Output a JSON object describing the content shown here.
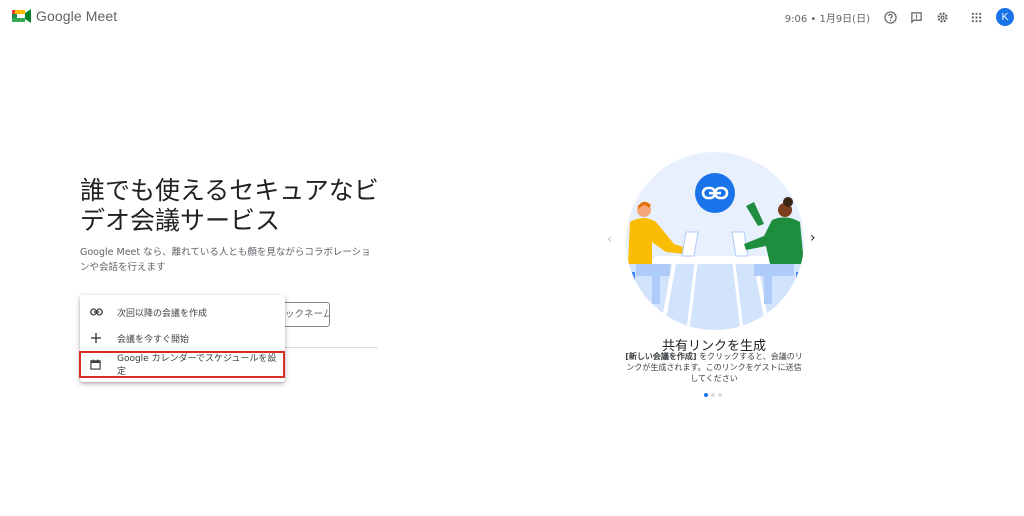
{
  "header": {
    "app_name": "Google Meet",
    "clock": "9:06 • 1月9日(日)",
    "avatar_letter": "K"
  },
  "hero": {
    "title": "誰でも使えるセキュアなビデオ会議サービス",
    "subtitle": "Google Meet なら、離れている人とも顔を見ながらコラボレーションや会話を行えます",
    "nickname_partial": "ックネームを"
  },
  "menu": {
    "items": [
      {
        "label": "次回以降の会議を作成",
        "icon": "link-icon"
      },
      {
        "label": "会議を今すぐ開始",
        "icon": "plus-icon"
      },
      {
        "label": "Google カレンダーでスケジュールを設定",
        "icon": "calendar-icon"
      }
    ]
  },
  "carousel": {
    "title": "共有リンクを生成",
    "desc_bold": "[新しい会議を作成]",
    "desc_rest": " をクリックすると、会議のリンクが生成されます。このリンクをゲストに送信してください",
    "prev": "‹",
    "next": "›",
    "active_index": 0,
    "count": 3
  },
  "colors": {
    "accent": "#1a73e8",
    "highlight": "#d93025"
  }
}
